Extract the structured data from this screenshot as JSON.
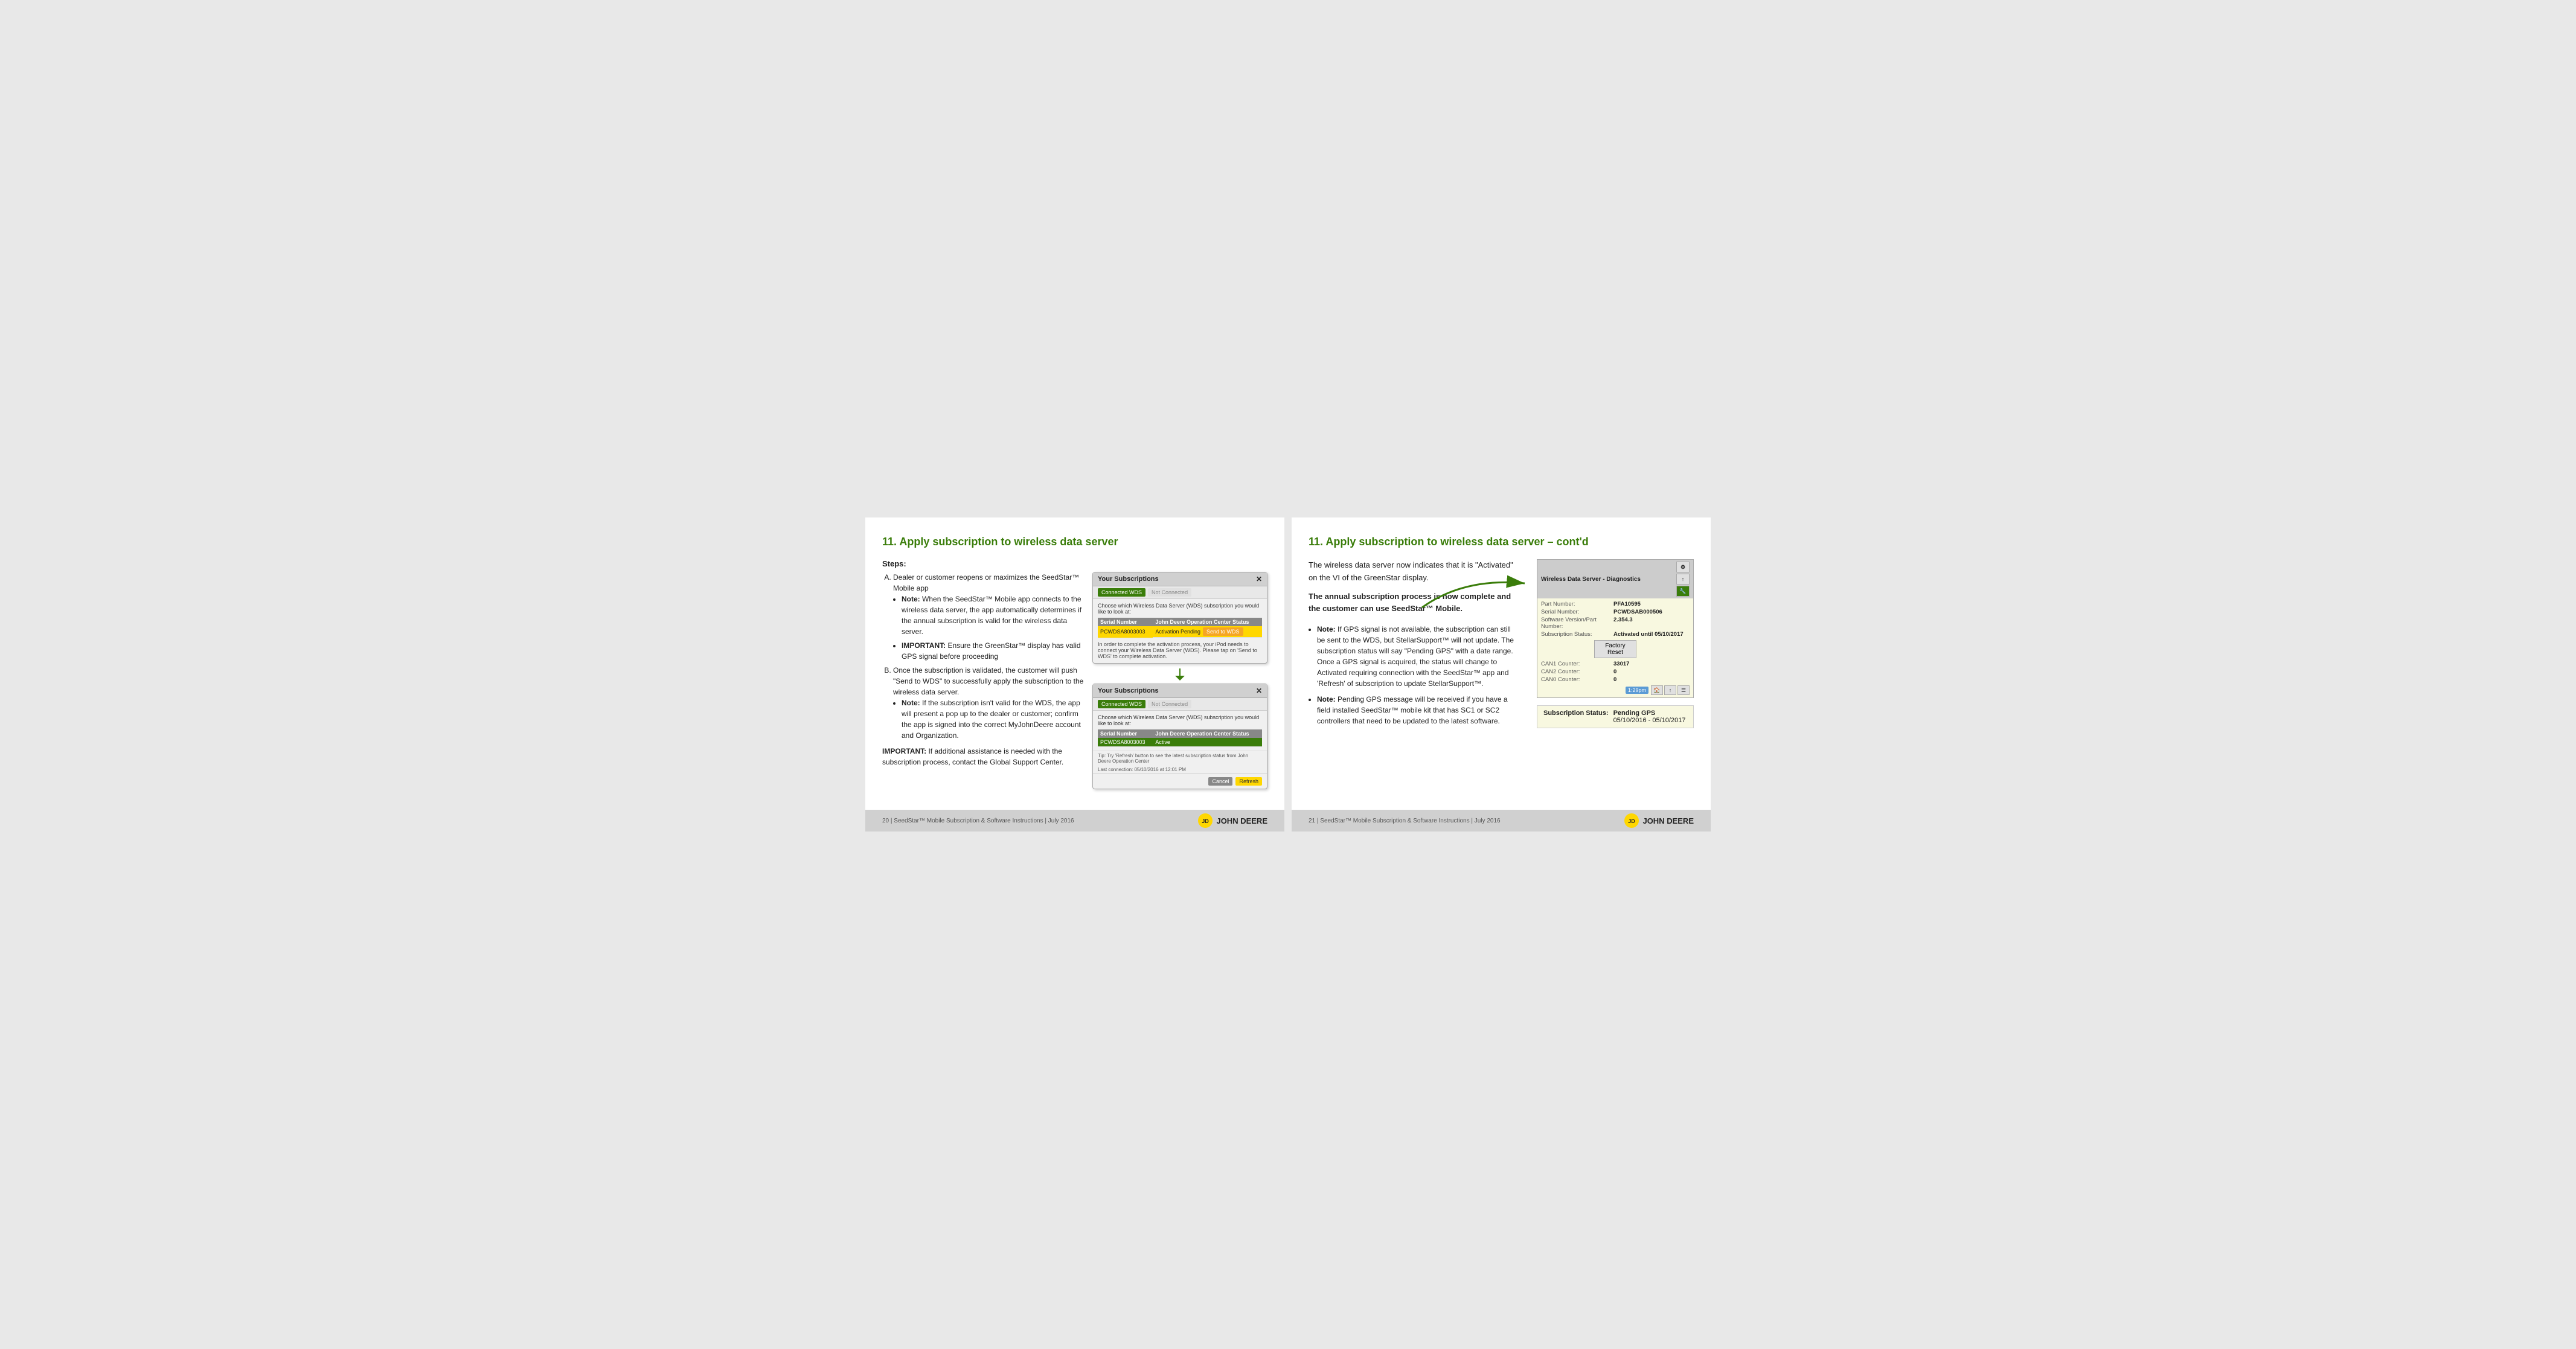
{
  "pages": [
    {
      "id": "page-left",
      "title": "11. Apply subscription to wireless data server",
      "steps_label": "Steps:",
      "steps": [
        {
          "letter": "A",
          "text": "Dealer or customer reopens or maximizes the SeedStar™ Mobile app",
          "bullets": [
            {
              "bold_prefix": "Note:",
              "text": " When the SeedStar™ Mobile app connects to the wireless data server, the app automatically determines if the annual subscription is valid for the wireless data server."
            },
            {
              "bold_prefix": "IMPORTANT:",
              "text": " Ensure the GreenStar™ display has valid GPS signal before proceeding"
            }
          ]
        },
        {
          "letter": "B",
          "text": "Once the subscription is validated, the customer will push \"Send to WDS\" to  successfully apply the subscription to the wireless data server.",
          "bullets": [
            {
              "bold_prefix": "Note:",
              "text": " If the subscription isn't valid for the WDS, the app will present a pop up to the dealer or customer; confirm the app is signed into the correct MyJohnDeere account and Organization."
            }
          ]
        }
      ],
      "important_note": "IMPORTANT:  If additional assistance is needed with the subscription process, contact the Global Support Center.",
      "dialog1": {
        "title": "Your Subscriptions",
        "tabs": [
          "Connected WDS",
          "Not Connected"
        ],
        "description": "Choose which Wireless Data Server (WDS) subscription you would like to look at:",
        "table_headers": [
          "Serial Number",
          "John Deere Operation Center Status"
        ],
        "rows": [
          {
            "serial": "PCWDSA8003003",
            "status": "Activation Pending",
            "highlighted": true,
            "action": "Send to WDS"
          }
        ],
        "body_note": "In order to complete the activation process, your iPod needs to connect your Wireless Data Server (WDS). Please tap on 'Send to WDS' to complete activation."
      },
      "dialog2": {
        "title": "Your Subscriptions",
        "tabs": [
          "Connected WDS",
          "Not Connected"
        ],
        "description": "Choose which Wireless Data Server (WDS) subscription you would like to look at:",
        "table_headers": [
          "Serial Number",
          "John Deere Operation Center Status"
        ],
        "rows": [
          {
            "serial": "PCWDSA8003003",
            "status": "Active",
            "active": true
          }
        ],
        "footer_note": "Tip: Try 'Refresh' button to see the latest subscription status from John Deere Operation Center",
        "last_connection": "Last connection: 05/10/2016 at 12:01 PM",
        "buttons": [
          "Cancel",
          "Refresh"
        ]
      },
      "footer": {
        "page_text": "20 | SeedStar™ Mobile Subscription & Software Instructions | July 2016",
        "logo_text": "JOHN DEERE"
      }
    },
    {
      "id": "page-right",
      "title": "11. Apply subscription to wireless data server – cont'd",
      "intro1": "The wireless data server now indicates that it is \"Activated\" on the VI of the GreenStar display.",
      "intro2": "The annual subscription process is now complete and the customer can use SeedStar™ Mobile.",
      "bullets": [
        {
          "bold_prefix": "Note:",
          "text": " If GPS signal is not available, the subscription can still be sent to the WDS, but StellarSupport™ will not update.  The subscription status will say \"Pending GPS\" with a date range.  Once a GPS signal is acquired, the status will change to Activated requiring connection with the SeedStar™ app and 'Refresh' of subscription to update StellarSupport™."
        },
        {
          "bold_prefix": "Note:",
          "text": " Pending GPS message will be received if you have a field installed SeedStar™ mobile kit that has SC1 or SC2 controllers that need to be updated to the latest software."
        }
      ],
      "wds_panel": {
        "title": "Wireless Data Server - Diagnostics",
        "part_number_label": "Part Number:",
        "part_number": "PFA10595",
        "serial_number_label": "Serial Number:",
        "serial_number": "PCWDSAB000506",
        "software_version_label": "Software Version/Part Number:",
        "software_version": "2.354.3",
        "subscription_status_label": "Subscription Status:",
        "subscription_status": "Activated until 05/10/2017",
        "factory_reset_label": "Factory Reset",
        "can1_label": "CAN1 Counter:",
        "can1_value": "33017",
        "can2_label": "CAN2 Counter:",
        "can2_value": "0",
        "can3_label": "CAN0 Counter:",
        "can3_value": "0",
        "time": "1:29pm"
      },
      "subscription_status_box": {
        "label": "Subscription Status:",
        "status": "Pending GPS",
        "date_range": "05/10/2016 - 05/10/2017"
      },
      "footer": {
        "page_text": "21 | SeedStar™ Mobile Subscription & Software Instructions | July 2016",
        "logo_text": "JOHN DEERE"
      }
    }
  ]
}
